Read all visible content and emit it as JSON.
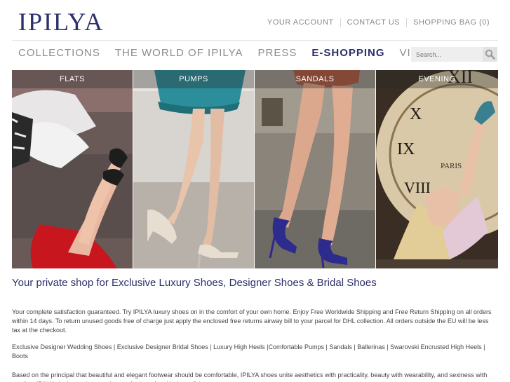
{
  "brand": {
    "logo": "IPILYA"
  },
  "util_nav": [
    "YOUR ACCOUNT",
    "CONTACT US",
    "SHOPPING BAG (0)"
  ],
  "main_nav": [
    "COLLECTIONS",
    "THE WORLD OF IPILYA",
    "PRESS",
    "E-SHOPPING",
    "VIDEO"
  ],
  "active_nav": "E-SHOPPING",
  "search": {
    "placeholder": "Search..."
  },
  "categories": [
    "FLATS",
    "PUMPS",
    "SANDALS",
    "EVENING"
  ],
  "content": {
    "headline": "Your private shop for Exclusive Luxury Shoes, Designer Shoes & Bridal Shoes",
    "paragraph1": "Your complete satisfaction guaranteed. Try IPILYA luxury shoes on in the comfort of your own home. Enjoy Free Worldwide Shipping and Free Return Shipping on all orders within 14 days. To return unused goods free of charge just apply the enclosed free returns airway bill to your parcel for DHL collection. All orders outside the EU will be less tax at the checkout.",
    "paragraph2": "Exclusive Designer Wedding Shoes | Exclusive Designer Bridal Shoes | Luxury High Heels |Comfortable Pumps | Sandals | Ballerinas | Swarovski Encrusted High Heels | Boots",
    "paragraph3": "Based on the principal that beautiful and elegant footwear should be comfortable, IPILYA shoes unite aesthetics with practicality, beauty with wearability, and sexiness with comfort. IPILYA designer shoes make you feel comfortably beautiful."
  },
  "colors": {
    "brand": "#2b2f6b",
    "nav_grey": "#8c8c8c"
  },
  "icons": {
    "search_button": "magnifier-icon"
  }
}
